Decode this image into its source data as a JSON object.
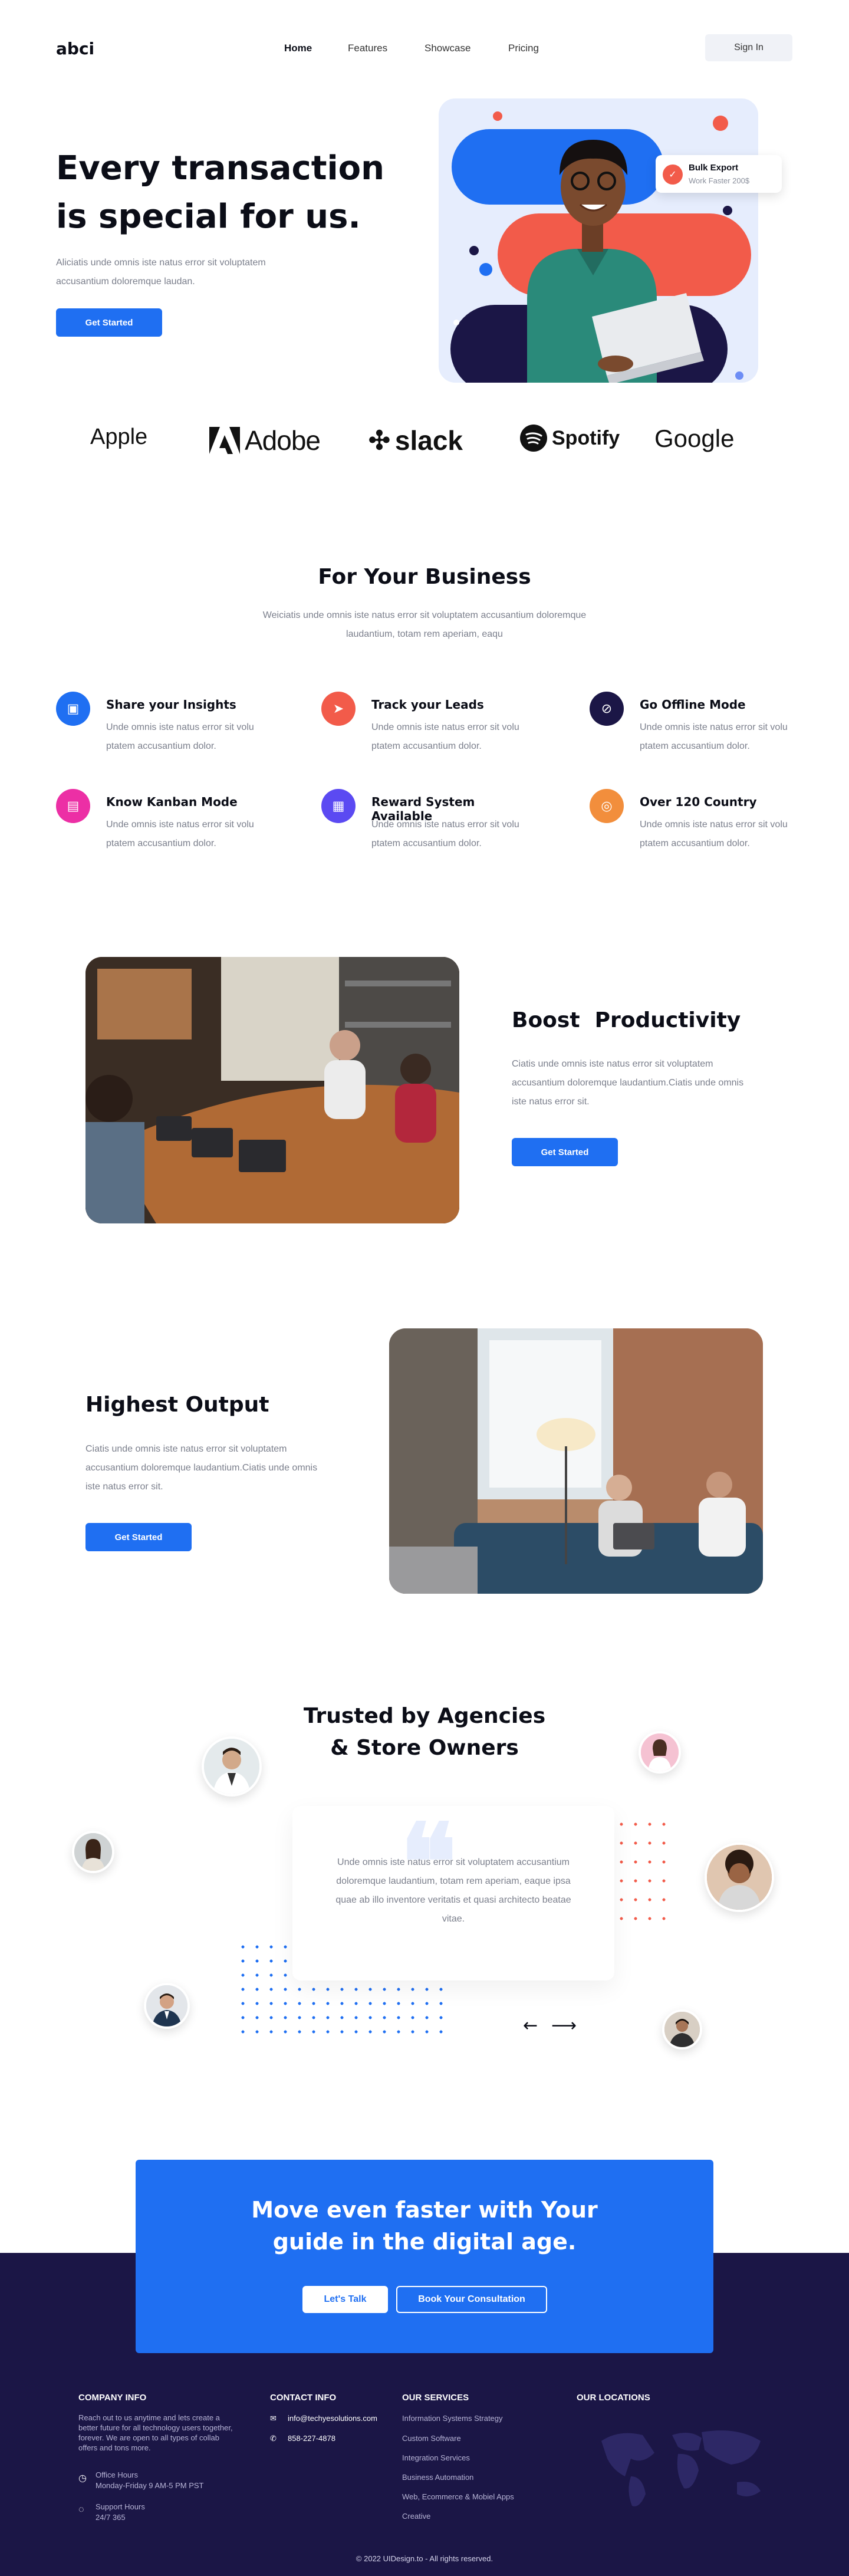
{
  "header": {
    "logo": "abci",
    "nav": [
      "Home",
      "Features",
      "Showcase",
      "Pricing"
    ],
    "signin": "Sign In"
  },
  "hero": {
    "title_line1": "Every transaction",
    "title_line2": "is special for us.",
    "subtitle": "Aliciatis unde omnis iste natus error sit voluptatem accusantium doloremque laudan.",
    "cta": "Get Started",
    "badge_title": "Bulk Export",
    "badge_sub": "Work Faster 200$"
  },
  "brands": [
    "Apple",
    "Adobe",
    "slack",
    "Spotify",
    "Google"
  ],
  "business": {
    "title": "For Your Business",
    "subtitle": "Weiciatis unde omnis iste natus error sit voluptatem accusantium doloremque laudantium, totam rem aperiam, eaqu",
    "features": [
      {
        "title": "Share your Insights",
        "desc": "Unde omnis iste natus error sit volu ptatem accusantium dolor.",
        "color": "#1f6ff2",
        "icon": "briefcase-icon"
      },
      {
        "title": "Track your Leads",
        "desc": "Unde omnis iste natus error sit volu ptatem accusantium dolor.",
        "color": "#f25b4a",
        "icon": "send-icon"
      },
      {
        "title": "Go Offline Mode",
        "desc": "Unde omnis iste natus error sit volu ptatem accusantium dolor.",
        "color": "#1b1646",
        "icon": "wifi-off-icon"
      },
      {
        "title": "Know Kanban Mode",
        "desc": "Unde omnis iste natus error sit volu ptatem accusantium dolor.",
        "color": "#ec2fa5",
        "icon": "kanban-icon"
      },
      {
        "title": "Reward System Available",
        "desc": "Unde omnis iste natus error sit volu ptatem accusantium dolor.",
        "color": "#5b4af2",
        "icon": "gift-icon"
      },
      {
        "title": "Over 120 Country",
        "desc": "Unde omnis iste natus error sit volu ptatem accusantium dolor.",
        "color": "#f28e3c",
        "icon": "globe-icon"
      }
    ]
  },
  "productivity": {
    "title": "Boost  Productivity",
    "desc": "Ciatis unde omnis iste natus error sit voluptatem accusantium doloremque laudantium.Ciatis unde omnis iste natus error sit.",
    "cta": "Get Started"
  },
  "output": {
    "title": "Highest Output",
    "desc": "Ciatis unde omnis iste natus error sit voluptatem accusantium doloremque laudantium.Ciatis unde omnis iste natus error sit.",
    "cta": "Get Started"
  },
  "trusted": {
    "title_line1": "Trusted by Agencies",
    "title_line2": "& Store Owners",
    "quote": "Unde omnis iste natus error sit voluptatem accusantium doloremque laudantium, totam rem aperiam, eaque ipsa quae ab illo inventore veritatis et quasi architecto beatae vitae."
  },
  "cta": {
    "title_line1": "Move even faster with Your",
    "title_line2": "guide in the digital age.",
    "btn1": "Let's Talk",
    "btn2": "Book Your Consultation"
  },
  "footer": {
    "company_heading": "COMPANY INFO",
    "company_text": "Reach out to us anytime and lets create a better future for all technology users together, forever. We are open to all types of collab offers and tons more.",
    "hours_label": "Office Hours",
    "hours_value": "Monday-Friday 9 AM-5 PM PST",
    "support_label": "Support Hours",
    "support_value": "24/7 365",
    "contact_heading": "CONTACT INFO",
    "email": "info@techyesolutions.com",
    "phone": "858-227-4878",
    "services_heading": "OUR SERVICES",
    "services": [
      "Information Systems Strategy",
      "Custom Software",
      "Integration Services",
      "Business Automation",
      "Web, Ecommerce & Mobiel Apps",
      "Creative"
    ],
    "locations_heading": "OUR LOCATIONS",
    "copyright": "© 2022 UIDesign.to - All rights reserved."
  }
}
